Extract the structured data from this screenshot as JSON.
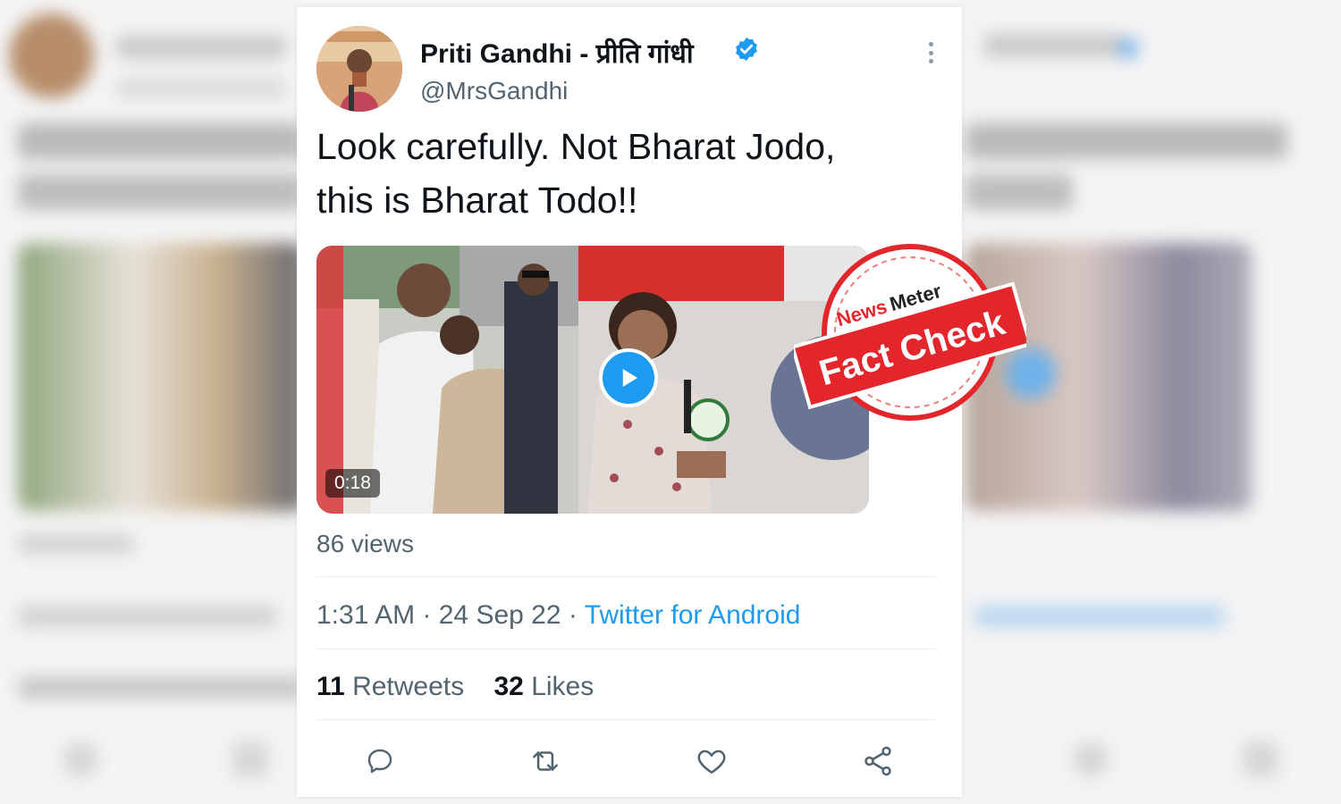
{
  "tweet": {
    "author_name": "Priti Gandhi - प्रीति गांधी",
    "handle": "@MrsGandhi",
    "text_line1": "Look carefully. Not Bharat Jodo,",
    "text_line2": "this is Bharat Todo!!",
    "video_duration": "0:18",
    "views": "86 views",
    "time": "1:31 AM",
    "date": "24 Sep 22",
    "source": "Twitter for Android",
    "retweets_count": "11",
    "retweets_label": "Retweets",
    "likes_count": "32",
    "likes_label": "Likes"
  },
  "stamp": {
    "brand_news": "News",
    "brand_meter": "Meter",
    "label": "Fact Check"
  },
  "colors": {
    "accent_blue": "#1d9bf0",
    "stamp_red": "#e3262b",
    "text_primary": "#0f1419",
    "text_secondary": "#536471"
  },
  "icons": {
    "verified": "verified-badge-icon",
    "more": "more-options-icon",
    "play": "play-icon",
    "reply": "reply-icon",
    "retweet": "retweet-icon",
    "like": "like-icon",
    "share": "share-icon"
  }
}
